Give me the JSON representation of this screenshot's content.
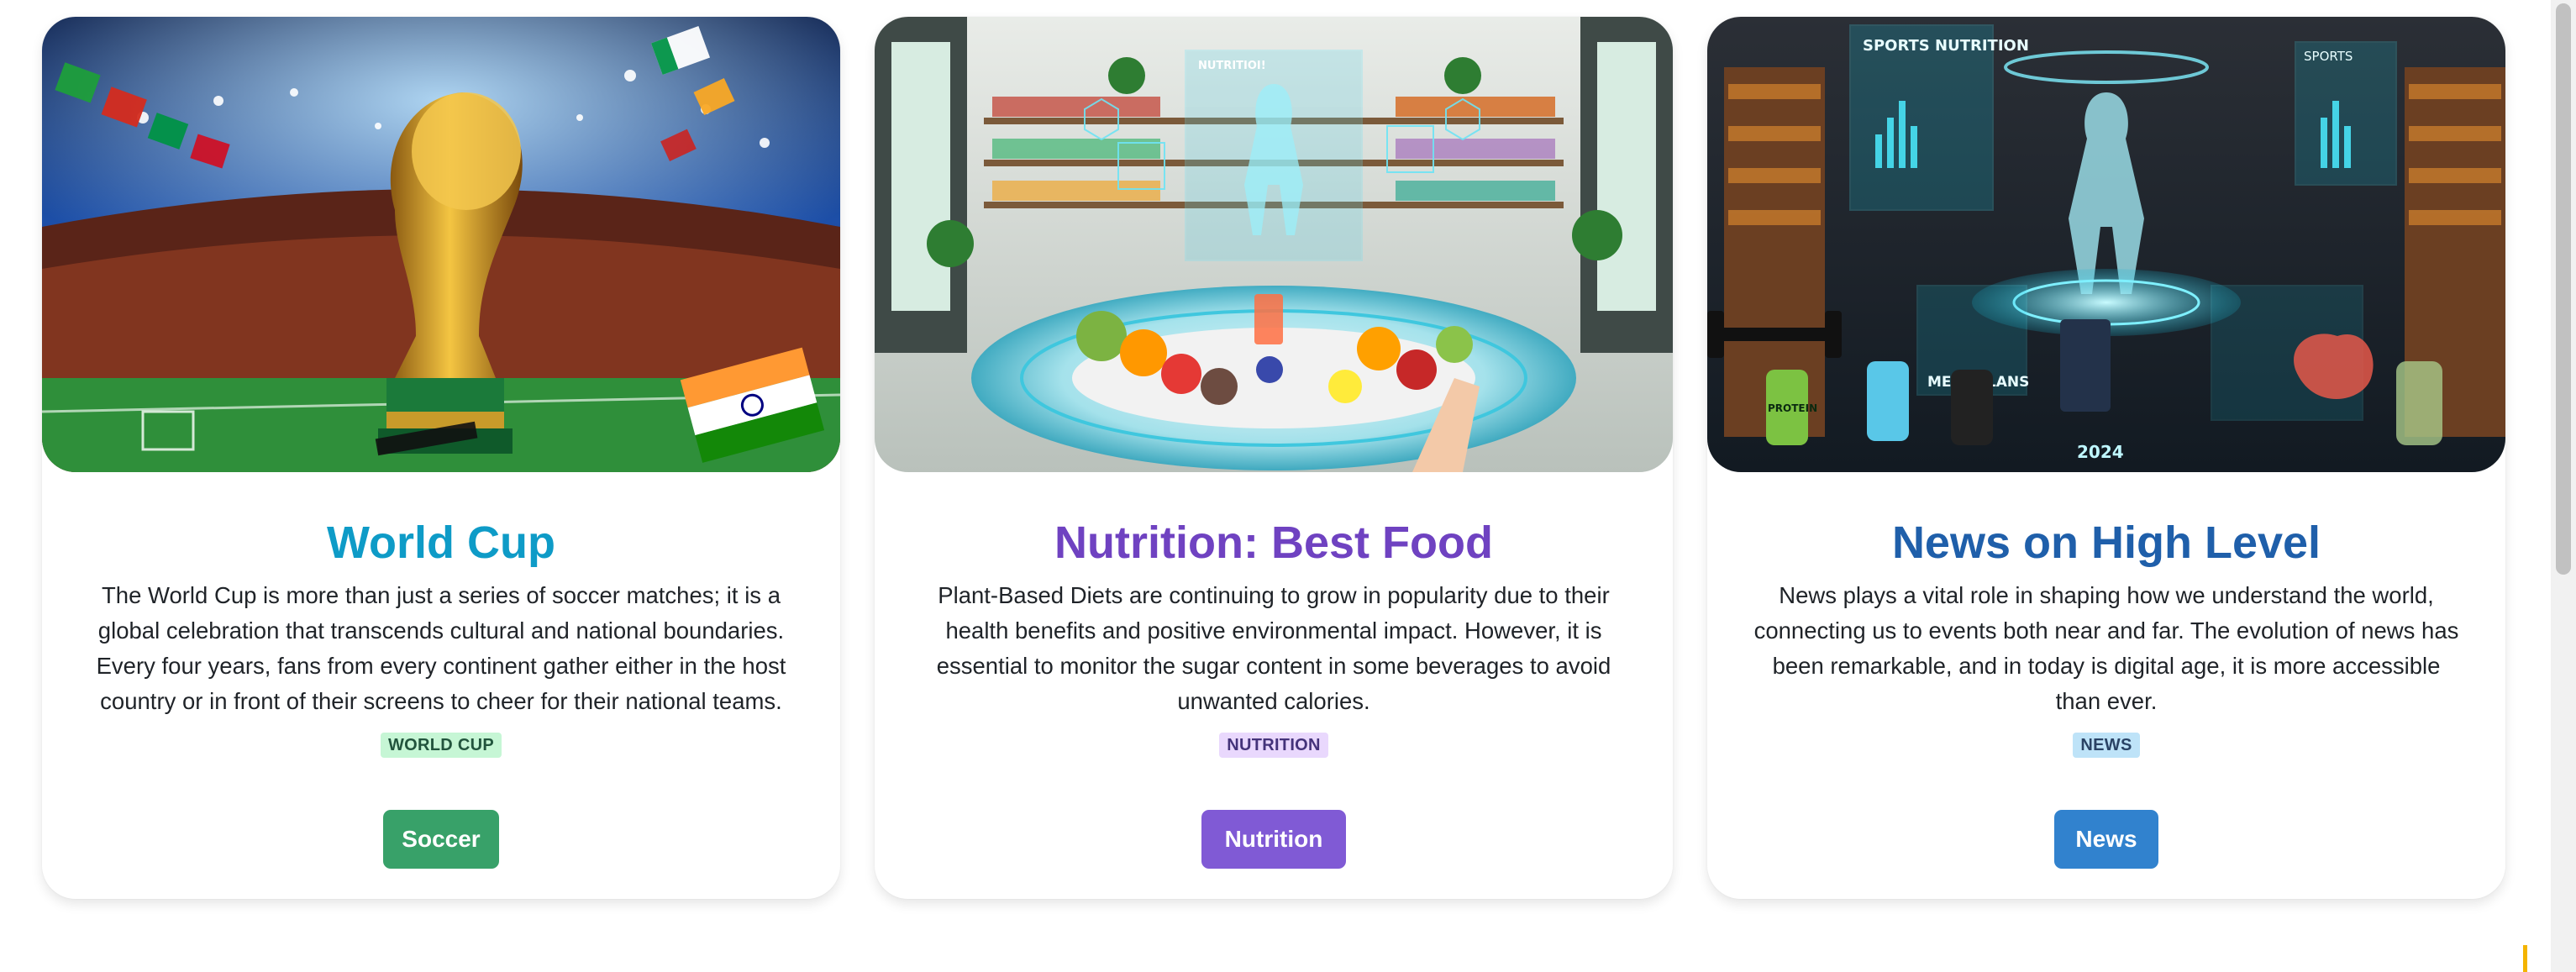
{
  "colors": {
    "worldcup_title": "#0e9bc7",
    "nutrition_title": "#6f42c1",
    "news_title": "#1f5faa",
    "worldcup_button": "#38a169",
    "nutrition_button": "#805ad5",
    "news_button": "#3182ce",
    "worldcup_tag_bg": "#c6f6d5",
    "worldcup_tag_fg": "#22543d",
    "nutrition_tag_bg": "#e9d8fd",
    "nutrition_tag_fg": "#44337a",
    "news_tag_bg": "#bee3f8",
    "news_tag_fg": "#2a4365"
  },
  "cards": [
    {
      "image_name": "world-cup-trophy-stadium-image",
      "image_text": [],
      "title": "World Cup",
      "description": "The World Cup is more than just a series of soccer matches; it is a global celebration that transcends cultural and national boundaries. Every four years, fans from every continent gather either in the host country or in front of their screens to cheer for their national teams.",
      "tag": "WORLD CUP",
      "button": "Soccer"
    },
    {
      "image_name": "nutrition-food-hologram-image",
      "image_text": [
        "NUTRITIOI!"
      ],
      "title": "Nutrition: Best Food",
      "description": "Plant-Based Diets are continuing to grow in popularity due to their health benefits and positive environmental impact. However, it is essential to monitor the sugar content in some beverages to avoid unwanted calories.",
      "tag": "NUTRITION",
      "button": "Nutrition"
    },
    {
      "image_name": "sports-nutrition-hologram-image",
      "image_text": [
        "SPORTS NUTRITION",
        "SPORTS",
        "MEAL PLANS",
        "PROTEIN",
        "2024"
      ],
      "title": "News on High Level",
      "description": "News plays a vital role in shaping how we understand the world, connecting us to events both near and far. The evolution of news has been remarkable, and in today is digital age, it is more accessible than ever.",
      "tag": "NEWS",
      "button": "News"
    }
  ]
}
